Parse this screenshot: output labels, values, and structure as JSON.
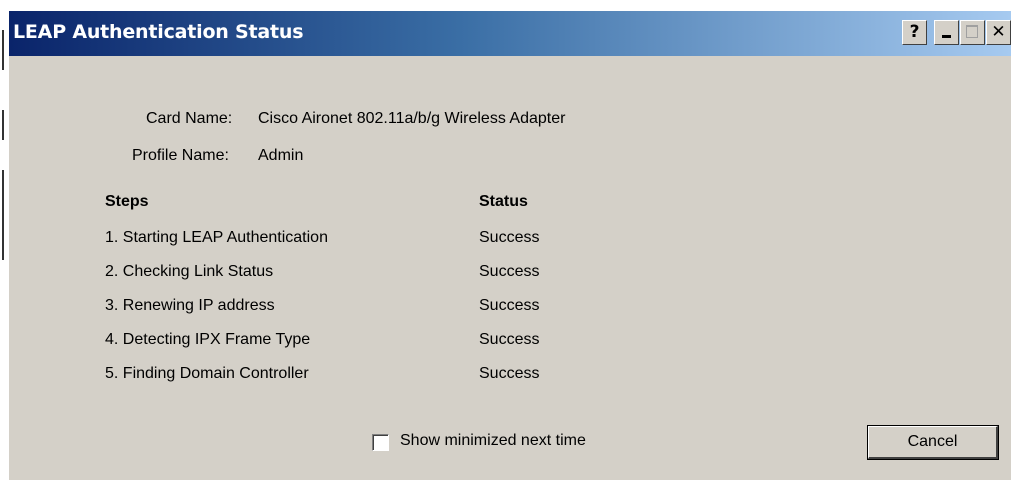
{
  "window": {
    "title": "LEAP Authentication Status",
    "controls": {
      "help": "?",
      "close": "✕"
    }
  },
  "info": {
    "card_name_label": "Card Name:",
    "card_name_value": "Cisco Aironet 802.11a/b/g Wireless Adapter",
    "profile_name_label": "Profile Name:",
    "profile_name_value": "Admin"
  },
  "table": {
    "headers": {
      "steps": "Steps",
      "status": "Status"
    },
    "rows": [
      {
        "step": "1. Starting LEAP Authentication",
        "status": "Success"
      },
      {
        "step": "2. Checking Link Status",
        "status": "Success"
      },
      {
        "step": "3. Renewing IP address",
        "status": "Success"
      },
      {
        "step": "4. Detecting IPX Frame Type",
        "status": "Success"
      },
      {
        "step": "5. Finding Domain Controller",
        "status": "Success"
      }
    ]
  },
  "footer": {
    "show_minimized_label": "Show minimized next time",
    "show_minimized_checked": false,
    "cancel_label": "Cancel"
  },
  "colors": {
    "titlebar_start": "#0a246a",
    "titlebar_end": "#a6caf0",
    "dialog_face": "#d4d0c8"
  }
}
